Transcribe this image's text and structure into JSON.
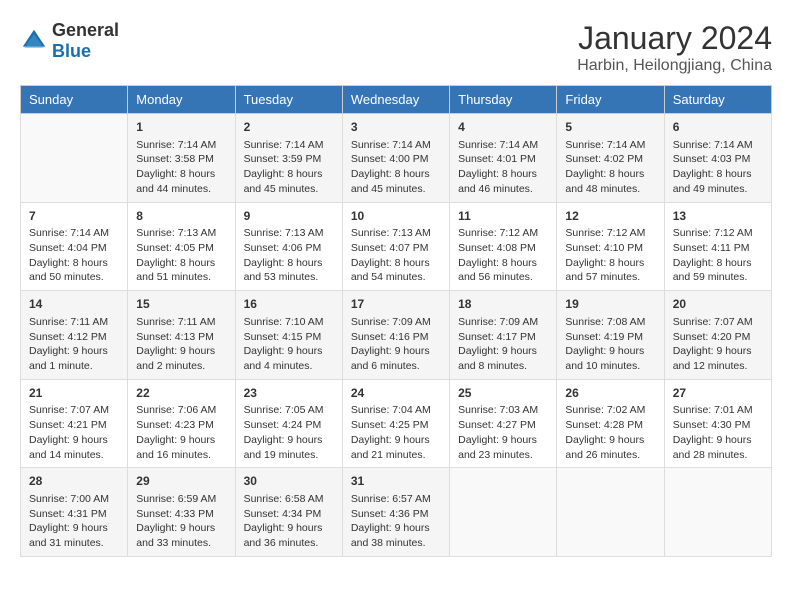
{
  "header": {
    "logo_general": "General",
    "logo_blue": "Blue",
    "main_title": "January 2024",
    "subtitle": "Harbin, Heilongjiang, China"
  },
  "calendar": {
    "days_of_week": [
      "Sunday",
      "Monday",
      "Tuesday",
      "Wednesday",
      "Thursday",
      "Friday",
      "Saturday"
    ],
    "weeks": [
      [
        {
          "day": "",
          "content": ""
        },
        {
          "day": "1",
          "content": "Sunrise: 7:14 AM\nSunset: 3:58 PM\nDaylight: 8 hours\nand 44 minutes."
        },
        {
          "day": "2",
          "content": "Sunrise: 7:14 AM\nSunset: 3:59 PM\nDaylight: 8 hours\nand 45 minutes."
        },
        {
          "day": "3",
          "content": "Sunrise: 7:14 AM\nSunset: 4:00 PM\nDaylight: 8 hours\nand 45 minutes."
        },
        {
          "day": "4",
          "content": "Sunrise: 7:14 AM\nSunset: 4:01 PM\nDaylight: 8 hours\nand 46 minutes."
        },
        {
          "day": "5",
          "content": "Sunrise: 7:14 AM\nSunset: 4:02 PM\nDaylight: 8 hours\nand 48 minutes."
        },
        {
          "day": "6",
          "content": "Sunrise: 7:14 AM\nSunset: 4:03 PM\nDaylight: 8 hours\nand 49 minutes."
        }
      ],
      [
        {
          "day": "7",
          "content": "Sunrise: 7:14 AM\nSunset: 4:04 PM\nDaylight: 8 hours\nand 50 minutes."
        },
        {
          "day": "8",
          "content": "Sunrise: 7:13 AM\nSunset: 4:05 PM\nDaylight: 8 hours\nand 51 minutes."
        },
        {
          "day": "9",
          "content": "Sunrise: 7:13 AM\nSunset: 4:06 PM\nDaylight: 8 hours\nand 53 minutes."
        },
        {
          "day": "10",
          "content": "Sunrise: 7:13 AM\nSunset: 4:07 PM\nDaylight: 8 hours\nand 54 minutes."
        },
        {
          "day": "11",
          "content": "Sunrise: 7:12 AM\nSunset: 4:08 PM\nDaylight: 8 hours\nand 56 minutes."
        },
        {
          "day": "12",
          "content": "Sunrise: 7:12 AM\nSunset: 4:10 PM\nDaylight: 8 hours\nand 57 minutes."
        },
        {
          "day": "13",
          "content": "Sunrise: 7:12 AM\nSunset: 4:11 PM\nDaylight: 8 hours\nand 59 minutes."
        }
      ],
      [
        {
          "day": "14",
          "content": "Sunrise: 7:11 AM\nSunset: 4:12 PM\nDaylight: 9 hours\nand 1 minute."
        },
        {
          "day": "15",
          "content": "Sunrise: 7:11 AM\nSunset: 4:13 PM\nDaylight: 9 hours\nand 2 minutes."
        },
        {
          "day": "16",
          "content": "Sunrise: 7:10 AM\nSunset: 4:15 PM\nDaylight: 9 hours\nand 4 minutes."
        },
        {
          "day": "17",
          "content": "Sunrise: 7:09 AM\nSunset: 4:16 PM\nDaylight: 9 hours\nand 6 minutes."
        },
        {
          "day": "18",
          "content": "Sunrise: 7:09 AM\nSunset: 4:17 PM\nDaylight: 9 hours\nand 8 minutes."
        },
        {
          "day": "19",
          "content": "Sunrise: 7:08 AM\nSunset: 4:19 PM\nDaylight: 9 hours\nand 10 minutes."
        },
        {
          "day": "20",
          "content": "Sunrise: 7:07 AM\nSunset: 4:20 PM\nDaylight: 9 hours\nand 12 minutes."
        }
      ],
      [
        {
          "day": "21",
          "content": "Sunrise: 7:07 AM\nSunset: 4:21 PM\nDaylight: 9 hours\nand 14 minutes."
        },
        {
          "day": "22",
          "content": "Sunrise: 7:06 AM\nSunset: 4:23 PM\nDaylight: 9 hours\nand 16 minutes."
        },
        {
          "day": "23",
          "content": "Sunrise: 7:05 AM\nSunset: 4:24 PM\nDaylight: 9 hours\nand 19 minutes."
        },
        {
          "day": "24",
          "content": "Sunrise: 7:04 AM\nSunset: 4:25 PM\nDaylight: 9 hours\nand 21 minutes."
        },
        {
          "day": "25",
          "content": "Sunrise: 7:03 AM\nSunset: 4:27 PM\nDaylight: 9 hours\nand 23 minutes."
        },
        {
          "day": "26",
          "content": "Sunrise: 7:02 AM\nSunset: 4:28 PM\nDaylight: 9 hours\nand 26 minutes."
        },
        {
          "day": "27",
          "content": "Sunrise: 7:01 AM\nSunset: 4:30 PM\nDaylight: 9 hours\nand 28 minutes."
        }
      ],
      [
        {
          "day": "28",
          "content": "Sunrise: 7:00 AM\nSunset: 4:31 PM\nDaylight: 9 hours\nand 31 minutes."
        },
        {
          "day": "29",
          "content": "Sunrise: 6:59 AM\nSunset: 4:33 PM\nDaylight: 9 hours\nand 33 minutes."
        },
        {
          "day": "30",
          "content": "Sunrise: 6:58 AM\nSunset: 4:34 PM\nDaylight: 9 hours\nand 36 minutes."
        },
        {
          "day": "31",
          "content": "Sunrise: 6:57 AM\nSunset: 4:36 PM\nDaylight: 9 hours\nand 38 minutes."
        },
        {
          "day": "",
          "content": ""
        },
        {
          "day": "",
          "content": ""
        },
        {
          "day": "",
          "content": ""
        }
      ]
    ]
  }
}
